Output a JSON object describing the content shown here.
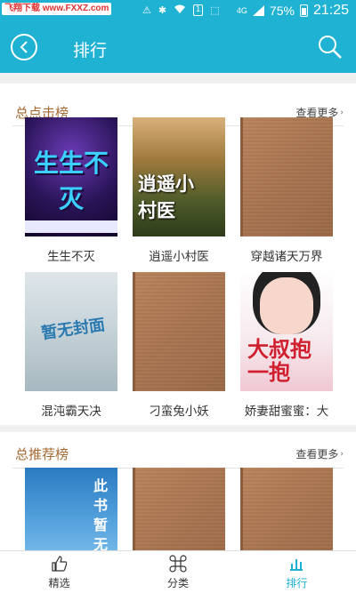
{
  "status_bar": {
    "watermark": "飞翔下载 www.FXXZ.com",
    "sim": "1",
    "network": "4G",
    "battery": "75%",
    "time": "21:25"
  },
  "header": {
    "title": "排行"
  },
  "sections": [
    {
      "title": "总点击榜",
      "more": "查看更多",
      "books": [
        {
          "title": "生生不灭",
          "cover_text": "生生不灭"
        },
        {
          "title": "逍遥小村医",
          "cover_text": "逍遥小村医"
        },
        {
          "title": "穿越诸天万界",
          "cover_text": ""
        },
        {
          "title": "混沌霸天决",
          "cover_text": "暂无封面"
        },
        {
          "title": "刁蛮兔小妖",
          "cover_text": ""
        },
        {
          "title": "娇妻甜蜜蜜：大",
          "cover_text": "大叔抱一抱"
        }
      ]
    },
    {
      "title": "总推荐榜",
      "more": "查看更多",
      "books": [
        {
          "title": "",
          "cover_text": "此书暂无封面"
        },
        {
          "title": "",
          "cover_text": ""
        },
        {
          "title": "",
          "cover_text": ""
        }
      ]
    }
  ],
  "bottom_nav": {
    "items": [
      "精选",
      "分类",
      "排行"
    ]
  }
}
